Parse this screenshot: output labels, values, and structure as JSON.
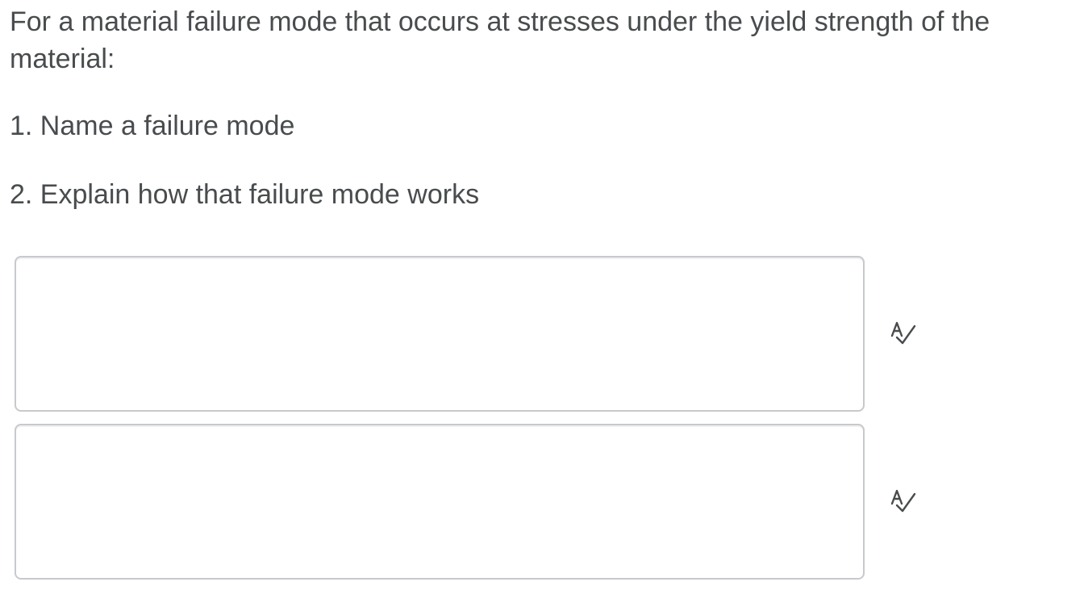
{
  "question": {
    "line1": "For a material failure mode that occurs at stresses under the yield strength of the",
    "line2": "material:",
    "item1": "1. Name a failure mode",
    "item2": "2. Explain how that failure mode works"
  },
  "answers": [
    {
      "value": "",
      "placeholder": "",
      "icon": "spellcheck-icon"
    },
    {
      "value": "",
      "placeholder": "",
      "icon": "spellcheck-icon"
    }
  ]
}
